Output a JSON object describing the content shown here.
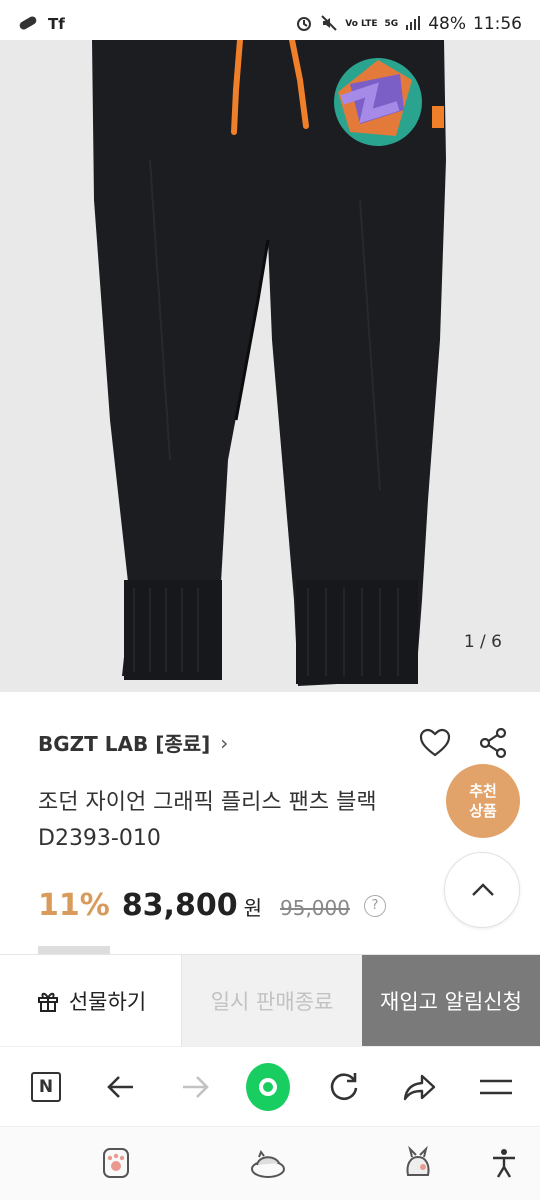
{
  "status_bar": {
    "battery": "48%",
    "time": "11:56",
    "network": "5G",
    "carrier_mark": "Vo LTE",
    "left_icons": [
      "link-icon",
      "tf-app-icon"
    ],
    "right_icons": [
      "alarm-icon",
      "mute-icon",
      "signal-icon"
    ]
  },
  "product": {
    "image_counter": "1 / 6",
    "brand": "BGZT LAB [종료]",
    "brand_chevron": "›",
    "title": "조던 자이언 그래픽 플리스 팬츠 블랙",
    "model": "D2393-010",
    "discount": "11%",
    "price": "83,800",
    "currency": "원",
    "original_price": "95,000",
    "help": "?",
    "recommend_badge": [
      "추천",
      "상품"
    ],
    "icons": [
      "heart-icon",
      "share-icon",
      "chevron-up-icon"
    ]
  },
  "actions": {
    "gift_label": "선물하기",
    "soldout_label": "일시 판매종료",
    "restock_label": "재입고 알림신청"
  },
  "browser_nav": {
    "naver_label": "N",
    "icons": [
      "naver-home-icon",
      "back-icon",
      "forward-icon",
      "green-dot-icon",
      "refresh-icon",
      "share-forward-icon",
      "menu-icon"
    ]
  },
  "system_nav": {
    "icons": [
      "paw-icon",
      "cat-bed-icon",
      "cat-icon",
      "accessibility-icon"
    ]
  },
  "colors": {
    "discount": "#d99b5b",
    "badge": "#e2a36a",
    "green": "#19ce60",
    "restock_bg": "#7a7a7a",
    "drawstring": "#f07f2a"
  }
}
